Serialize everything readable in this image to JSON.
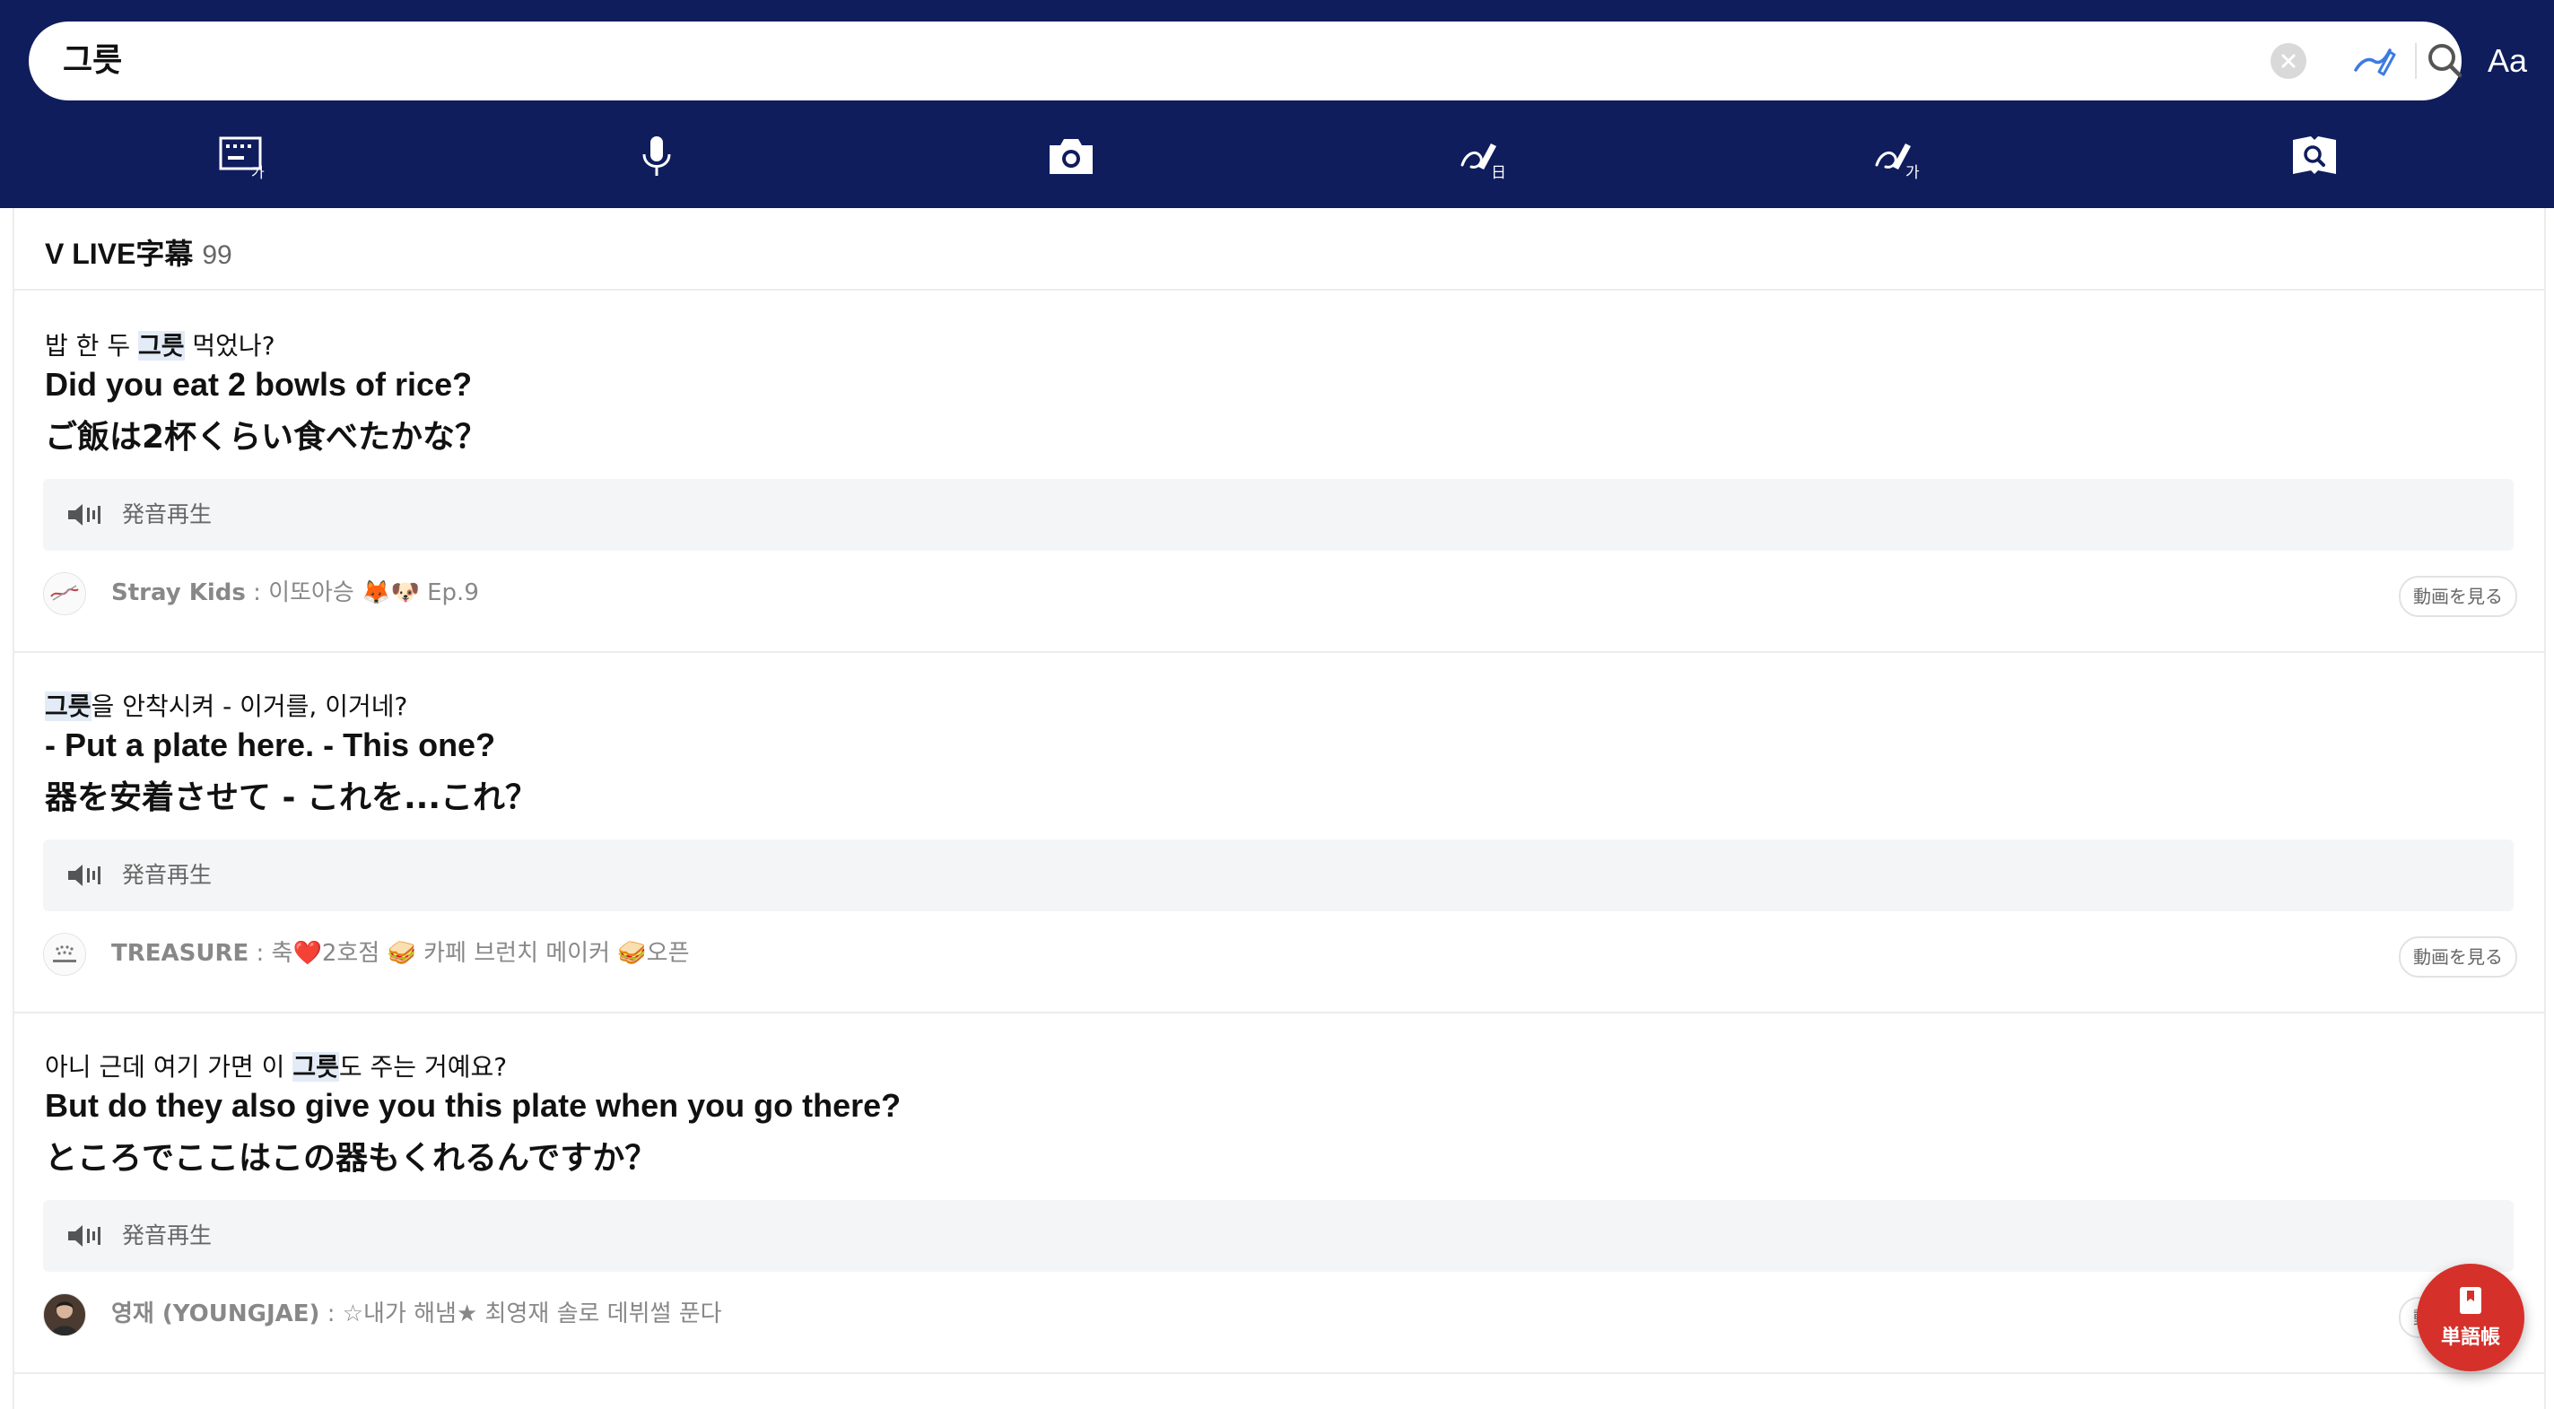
{
  "search": {
    "query": "그릇"
  },
  "header": {
    "font_button": "Aa",
    "tools": [
      {
        "name": "keyboard-korean-icon"
      },
      {
        "name": "microphone-icon"
      },
      {
        "name": "camera-icon"
      },
      {
        "name": "handwriting-japanese-icon"
      },
      {
        "name": "handwriting-korean-icon"
      },
      {
        "name": "image-search-icon"
      }
    ]
  },
  "panel": {
    "title": "V LIVE字幕",
    "count": "99"
  },
  "entries": [
    {
      "ko_before": "밥 한 두 ",
      "ko_highlight": "그릇",
      "ko_after": " 먹었나?",
      "en": "Did you eat 2 bowls of rice?",
      "ja": "ご飯は2杯くらい食べたかな？",
      "audio_label": "発音再生",
      "artist": "Stray Kids",
      "episode": " : 이또아승 🦊🐶 Ep.9",
      "watch_label": "動画を見る"
    },
    {
      "ko_before": "",
      "ko_highlight": "그릇",
      "ko_after": "을 안착시켜 - 이거를, 이거네?",
      "en": "- Put a plate here. - This one?",
      "ja": "器を安着させて - これを...これ？",
      "audio_label": "発音再生",
      "artist": "TREASURE",
      "episode": " : 축❤️2호점 🥪 카페 브런치 메이커 🥪오픈",
      "watch_label": "動画を見る"
    },
    {
      "ko_before": "아니 근데 여기 가면 이 ",
      "ko_highlight": "그릇",
      "ko_after": "도 주는 거예요?",
      "en": "But do they also give you this plate when you go there?",
      "ja": "ところでここはこの器もくれるんですか？",
      "audio_label": "発音再生",
      "artist": "영재 (YOUNGJAE)",
      "episode": " : ☆내가 해냄★ 최영재 솔로 데뷔썰 푼다",
      "watch_label": "動画を見る"
    }
  ],
  "fab": {
    "label": "単語帳"
  },
  "colors": {
    "header_bg": "#0f1d5c",
    "accent": "#d6302a",
    "highlight": "#e3ebf7"
  }
}
